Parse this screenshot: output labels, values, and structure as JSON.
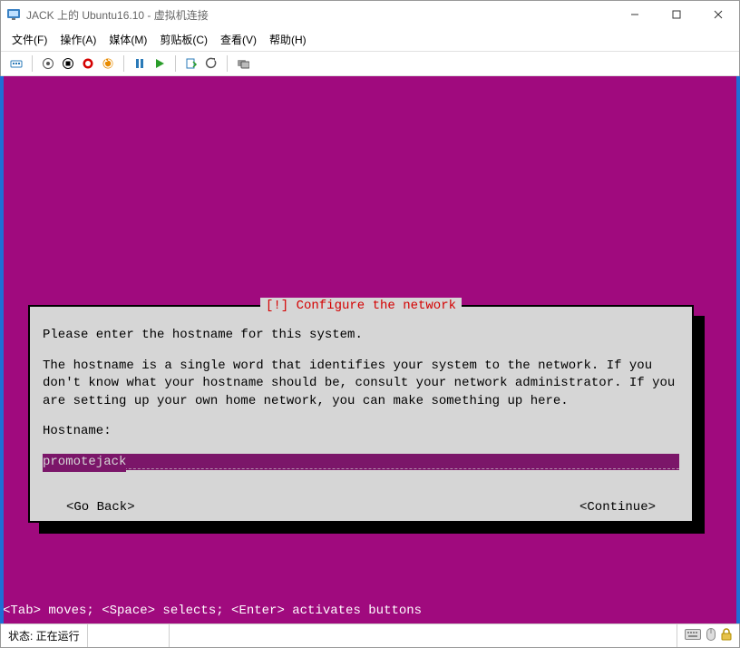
{
  "window": {
    "title": "JACK 上的 Ubuntu16.10 - 虚拟机连接"
  },
  "menu": {
    "file": "文件(F)",
    "action": "操作(A)",
    "media": "媒体(M)",
    "clipboard": "剪贴板(C)",
    "view": "查看(V)",
    "help": "帮助(H)"
  },
  "dialog": {
    "title": "[!] Configure the network",
    "line1": "Please enter the hostname for this system.",
    "line2": "The hostname is a single word that identifies your system to the network. If you don't know what your hostname should be, consult your network administrator. If you are setting up your own home network, you can make something up here.",
    "hostname_label": "Hostname:",
    "hostname_value": "promotejack",
    "go_back": "<Go Back>",
    "continue": "<Continue>"
  },
  "hint": "<Tab> moves; <Space> selects; <Enter> activates buttons",
  "status": {
    "label": "状态: 正在运行"
  }
}
